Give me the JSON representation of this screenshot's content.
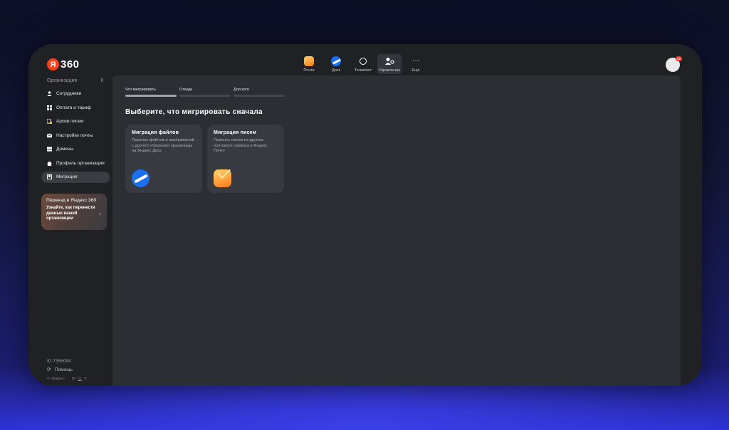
{
  "header": {
    "logo_mark": "Я",
    "logo_text": "360",
    "apps": [
      {
        "label": "Почта",
        "icon": "mail-icon"
      },
      {
        "label": "Диск",
        "icon": "disk-icon"
      },
      {
        "label": "Телемост",
        "icon": "telemost-icon"
      },
      {
        "label": "Управление",
        "icon": "admin-icon",
        "active": true
      },
      {
        "label": "Ещё",
        "icon": "more-icon"
      }
    ],
    "more_glyph": "···",
    "avatar_badge": "98"
  },
  "sidebar": {
    "org_label": "Организация",
    "org_chevron": "⇕",
    "items": [
      {
        "label": "Сотрудники",
        "icon": "person-icon"
      },
      {
        "label": "Оплата и тариф",
        "icon": "grid-icon"
      },
      {
        "label": "Архив писем",
        "icon": "archive-lock-icon"
      },
      {
        "label": "Настройки почты",
        "icon": "envelope-icon"
      },
      {
        "label": "Домены",
        "icon": "domains-icon"
      },
      {
        "label": "Профиль организации",
        "icon": "home-icon"
      },
      {
        "label": "Миграция",
        "icon": "migration-icon",
        "active": true
      }
    ],
    "promo": {
      "title": "Переезд в Яндекс 360",
      "text": "Узнайте, как перенести данные вашей организации",
      "arrow": "›"
    },
    "footer": {
      "org_id": "ID 7356094",
      "help": "Помощь",
      "copyright": "© «Яндекс»",
      "lang": "En",
      "lang2": "Uz",
      "lang3": "Tr"
    }
  },
  "main": {
    "steps": [
      {
        "label": "Что мигрировать",
        "done": true
      },
      {
        "label": "Откуда",
        "done": false
      },
      {
        "label": "Для кого",
        "done": false
      }
    ],
    "heading": "Выберите, что мигрировать сначала",
    "cards": [
      {
        "title": "Миграция файлов",
        "desc": "Перенос файлов и изображений с другого облачного хранилища на Яндекс Диск",
        "icon": "disk-icon"
      },
      {
        "title": "Миграция писем",
        "desc": "Перенос писем из другого почтового сервиса в Яндекс Почту",
        "icon": "mail-icon"
      }
    ]
  },
  "colors": {
    "accent_logo": "#fc3f1d",
    "panel": "#2b2e33",
    "card": "#373a40",
    "sidebar_active": "#3a3d43"
  }
}
